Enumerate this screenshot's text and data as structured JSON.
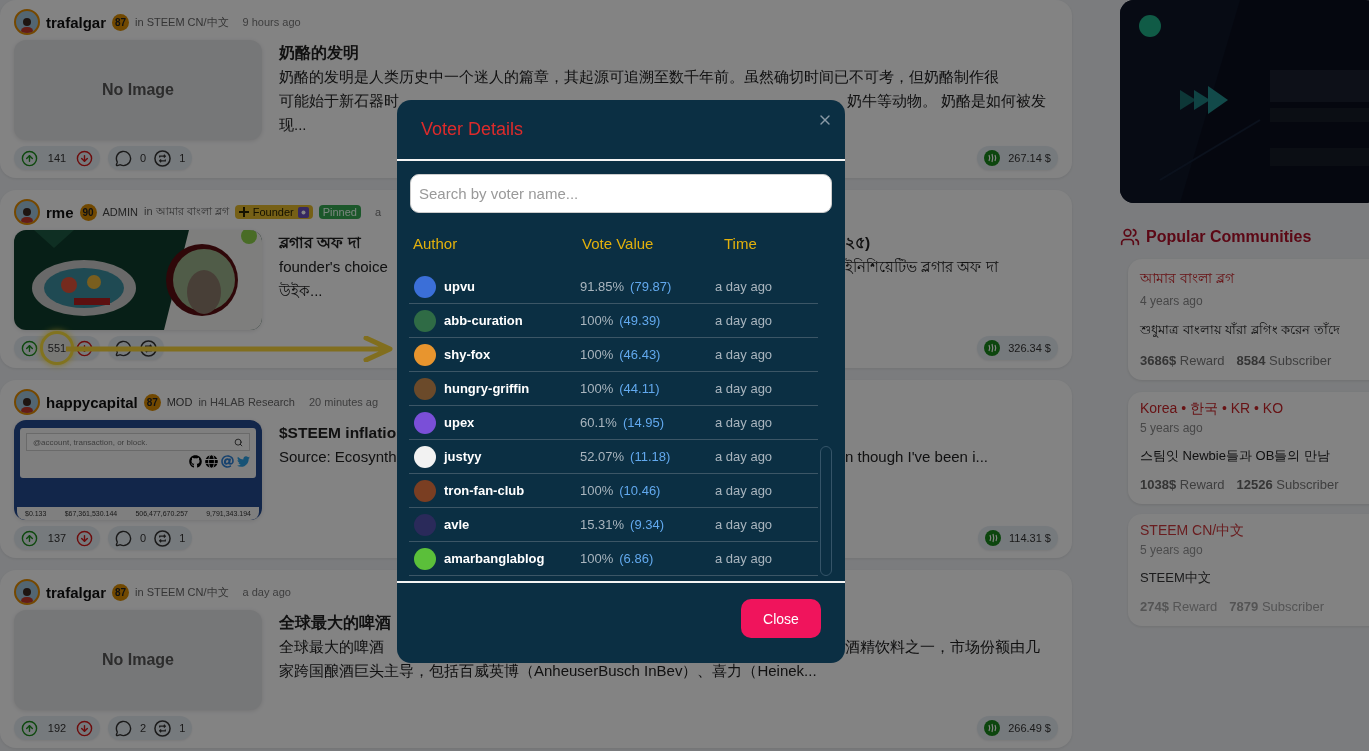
{
  "feed": {
    "posts": [
      {
        "author": "trafalgar",
        "reputation": "87",
        "community": "in STEEM CN/中文",
        "time": "9 hours ago",
        "image": {
          "kind": "none",
          "label": "No Image"
        },
        "title": {
          "left": "奶酪的发明"
        },
        "excerpt": [
          {
            "left": "奶酪的发明是人类历史中一个迷人的篇章，其起源可追溯至数千年前。虽然确切时间已不可考，但奶酪制作很"
          },
          {
            "left": "可能始于新石器时",
            "right": "奶牛等动物。 奶酪是如何被发"
          },
          {
            "left": "现..."
          }
        ],
        "votes": "141",
        "comments": "0",
        "reblogs": "1",
        "payout": "267.14 $",
        "highlighted": false
      },
      {
        "author": "rme",
        "reputation": "90",
        "role": "ADMIN",
        "community": "in আমার বাংলা ব্লগ",
        "badges": [
          {
            "kind": "founder",
            "label": "Founder"
          },
          {
            "kind": "pinned",
            "label": "Pinned"
          }
        ],
        "time": "a",
        "image": {
          "kind": "picture"
        },
        "title": {
          "left": "ব্লগার অফ দা",
          "right": "২৫)"
        },
        "excerpt": [
          {
            "left": "founder's choice",
            "right": "ইনিশিয়েটিভ ব্লগার অফ দা"
          },
          {
            "left": "উইক..."
          }
        ],
        "votes": "551",
        "payout": "326.34 $",
        "highlighted": true
      },
      {
        "author": "happycapital",
        "reputation": "87",
        "role": "MOD",
        "community": "in H4LAB Research",
        "time": "20 minutes ag",
        "image": {
          "kind": "screenshot",
          "placeholder": "@account, transaction, or block.",
          "figures": [
            "$0.133",
            "$67,361,530.144",
            "506,477,670.257",
            "9,791,343.194"
          ]
        },
        "title": {
          "left": "$STEEM inflatio"
        },
        "excerpt": [
          {
            "left": "Source: Ecosynth",
            "right": "n though I've been i..."
          }
        ],
        "votes": "137",
        "comments": "0",
        "reblogs": "1",
        "payout": "114.31 $",
        "highlighted": false
      },
      {
        "author": "trafalgar",
        "reputation": "87",
        "community": "in STEEM CN/中文",
        "time": "a day ago",
        "image": {
          "kind": "none",
          "label": "No Image"
        },
        "title": {
          "left": "全球最大的啤酒"
        },
        "excerpt": [
          {
            "left": "全球最大的啤酒",
            "right": "酒精饮料之一，市场份额由几"
          },
          {
            "left": "家跨国酿酒巨头主导，包括百威英博（AnheuserBusch InBev）、喜力（Heinek..."
          }
        ],
        "votes": "192",
        "comments": "2",
        "reblogs": "1",
        "payout": "266.49 $",
        "highlighted": false
      }
    ]
  },
  "sidebar": {
    "banner": {
      "kind": "picture"
    },
    "title": "Popular Communities",
    "communities": [
      {
        "name": "আমার বাংলা ব্লগ",
        "age": "4 years ago",
        "description": "শুধুমাত্র বাংলায় যাঁরা ব্লগিং করেন তাঁদে",
        "reward": "**3686$** Reward",
        "subscribers": "**8584** Subscriber",
        "faded": false
      },
      {
        "name": "Korea • 한국 • KR • KO",
        "age": "5 years ago",
        "description": "스팀잇 Newbie들과 OB들의 만남",
        "reward": "**1038$** Reward",
        "subscribers": "**12526** Subscriber",
        "faded": false
      },
      {
        "name": "STEEM CN/中文",
        "age": "5 years ago",
        "description": "STEEM中文",
        "reward": "**274$** Reward",
        "subscribers": "**7879** Subscriber",
        "faded": true
      }
    ]
  },
  "modal": {
    "title": "Voter Details",
    "search": {
      "placeholder": "Search by voter name..."
    },
    "columns": [
      "Author",
      "Vote Value",
      "Time"
    ],
    "voters": [
      {
        "name": "upvu",
        "percent": "91.85%",
        "value": "(79.87)",
        "time": "a day ago",
        "color": "#3b6fd8"
      },
      {
        "name": "abb-curation",
        "percent": "100%",
        "value": "(49.39)",
        "time": "a day ago",
        "color": "#2f6b45"
      },
      {
        "name": "shy-fox",
        "percent": "100%",
        "value": "(46.43)",
        "time": "a day ago",
        "color": "#e8952e"
      },
      {
        "name": "hungry-griffin",
        "percent": "100%",
        "value": "(44.11)",
        "time": "a day ago",
        "color": "#6b4a2a"
      },
      {
        "name": "upex",
        "percent": "60.1%",
        "value": "(14.95)",
        "time": "a day ago",
        "color": "#7a4fd8"
      },
      {
        "name": "justyy",
        "percent": "52.07%",
        "value": "(11.18)",
        "time": "a day ago",
        "color": "#f2f2f2"
      },
      {
        "name": "tron-fan-club",
        "percent": "100%",
        "value": "(10.46)",
        "time": "a day ago",
        "color": "#7a3e22"
      },
      {
        "name": "avle",
        "percent": "15.31%",
        "value": "(9.34)",
        "time": "a day ago",
        "color": "#2a2a5a"
      },
      {
        "name": "amarbanglablog",
        "percent": "100%",
        "value": "(6.86)",
        "time": "a day ago",
        "color": "#5bbf3a"
      }
    ],
    "close_label": "Close"
  }
}
